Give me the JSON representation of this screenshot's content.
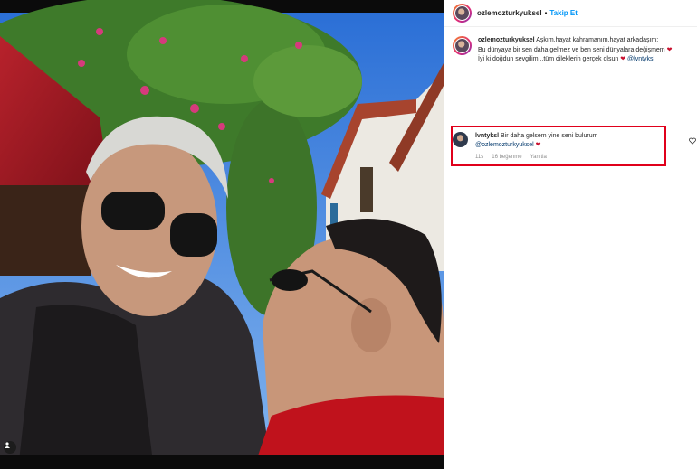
{
  "post": {
    "username": "ozlemozturkyuksel",
    "separator": "•",
    "follow_label": "Takip Et",
    "more_icon": "more-horizontal-icon"
  },
  "caption": {
    "username": "ozlemozturkyuksel",
    "line1": " Aşkım,hayat kahramanım,hayat arkadaşım;",
    "line2": "Bu dünyaya bir sen daha gelmez ve ben seni dünyalara değişmem",
    "line3": "İyi ki doğdun sevgilim ..tüm dileklerin gerçek olsun",
    "mention": "@lvntyksl",
    "heart_icon": "red-heart-icon"
  },
  "comment": {
    "username": "lvntyksl",
    "text": " Bir daha gelsem yine seni bulurum",
    "mention": "@ozlemozturkyuksel",
    "time": "11s",
    "likes": "16 beğenme",
    "reply_label": "Yanıtla"
  },
  "colors": {
    "accent": "#0095f6",
    "highlight_border": "#e0001b",
    "heart": "#c8102e"
  }
}
